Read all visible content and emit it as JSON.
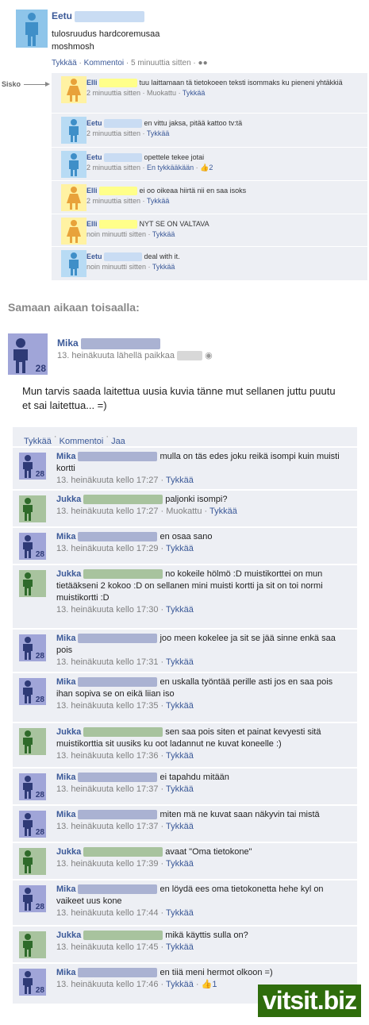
{
  "post1": {
    "author": "Eetu",
    "lines": [
      "tulosruudus hardcoremusaa",
      "moshmosh"
    ],
    "like": "Tykkää",
    "comment": "Kommentoi",
    "time": "5 minuuttia sitten"
  },
  "sisko_label": "Sisko",
  "comments1": [
    {
      "author": "Elli",
      "gender": "f",
      "text": "tuu laittamaan tä tietokoeen teksti isommaks ku pieneni yhtäkkiä",
      "time": "2 minuuttia sitten",
      "extra": "Muokattu",
      "like": "Tykkää"
    },
    {
      "author": "Eetu",
      "gender": "m",
      "text": "en vittu jaksa, pitää kattoo tv:tä",
      "time": "2 minuuttia sitten",
      "extra": "",
      "like": "Tykkää"
    },
    {
      "author": "Eetu",
      "gender": "m",
      "text": "opettele tekee jotai",
      "time": "2 minuuttia sitten",
      "extra": "",
      "like": "En tykkääkään",
      "likes": "2"
    },
    {
      "author": "Elli",
      "gender": "f",
      "text": "ei oo oikeaa hiirtä nii en saa isoks",
      "time": "2 minuuttia sitten",
      "extra": "",
      "like": "Tykkää"
    },
    {
      "author": "Elli",
      "gender": "f",
      "text": "NYT SE ON VALTAVA",
      "time": "noin minuutti sitten",
      "extra": "",
      "like": "Tykkää"
    },
    {
      "author": "Eetu",
      "gender": "m",
      "text": "deal with it.",
      "time": "noin minuutti sitten",
      "extra": "",
      "like": "Tykkää"
    }
  ],
  "section_title": "Samaan aikaan toisaalla:",
  "post2": {
    "author": "Mika",
    "age": "28",
    "meta": "13. heinäkuuta lähellä paikkaa",
    "text": "Mun tarvis saada laitettua uusia kuvia tänne mut sellanen juttu puutu et sai laitettua... =)",
    "actions": [
      "Tykkää",
      "Kommentoi",
      "Jaa"
    ]
  },
  "comments2": [
    {
      "author": "Mika",
      "who": "mika",
      "text": "mulla on täs edes joku reikä isompi kuin muisti kortti",
      "time": "13. heinäkuuta kello 17:27",
      "extra": "",
      "like": "Tykkää"
    },
    {
      "author": "Jukka",
      "who": "jukka",
      "text": "paljonki isompi?",
      "time": "13. heinäkuuta kello 17:27",
      "extra": "Muokattu",
      "like": "Tykkää"
    },
    {
      "author": "Mika",
      "who": "mika",
      "text": "en osaa sano",
      "time": "13. heinäkuuta kello 17:29",
      "extra": "",
      "like": "Tykkää"
    },
    {
      "author": "Jukka",
      "who": "jukka",
      "text": "no kokeile hölmö :D muistikorttei on mun tietääkseni 2 kokoo :D on sellanen mini muisti kortti ja sit on toi normi muistikortti :D",
      "time": "13. heinäkuuta kello 17:30",
      "extra": "",
      "like": "Tykkää"
    },
    {
      "author": "Mika",
      "who": "mika",
      "text": "joo meen kokelee ja sit se jää sinne enkä saa pois",
      "time": "13. heinäkuuta kello 17:31",
      "extra": "",
      "like": "Tykkää"
    },
    {
      "author": "Mika",
      "who": "mika",
      "text": "en uskalla työntää perille asti jos en saa pois ihan sopiva se on eikä liian iso",
      "time": "13. heinäkuuta kello 17:35",
      "extra": "",
      "like": "Tykkää"
    },
    {
      "author": "Jukka",
      "who": "jukka",
      "text": "sen saa pois siten et painat kevyesti sitä muistikorttia sit uusiks ku oot ladannut ne kuvat koneelle :)",
      "time": "13. heinäkuuta kello 17:36",
      "extra": "",
      "like": "Tykkää"
    },
    {
      "author": "Mika",
      "who": "mika",
      "text": "ei tapahdu mitään",
      "time": "13. heinäkuuta kello 17:37",
      "extra": "",
      "like": "Tykkää"
    },
    {
      "author": "Mika",
      "who": "mika",
      "text": "miten mä ne kuvat saan näkyvin tai mistä",
      "time": "13. heinäkuuta kello 17:37",
      "extra": "",
      "like": "Tykkää"
    },
    {
      "author": "Jukka",
      "who": "jukka",
      "text": "avaat \"Oma tietokone\"",
      "time": "13. heinäkuuta kello 17:39",
      "extra": "",
      "like": "Tykkää"
    },
    {
      "author": "Mika",
      "who": "mika",
      "text": "en löydä ees oma tietokonetta hehe kyl on vaikeet uus kone",
      "time": "13. heinäkuuta kello 17:44",
      "extra": "",
      "like": "Tykkää"
    },
    {
      "author": "Jukka",
      "who": "jukka",
      "text": "mikä käyttis sulla on?",
      "time": "13. heinäkuuta kello 17:45",
      "extra": "",
      "like": "Tykkää"
    },
    {
      "author": "Mika",
      "who": "mika",
      "text": "en tiiä meni hermot olkoon =)",
      "time": "13. heinäkuuta kello 17:46",
      "extra": "",
      "like": "Tykkää",
      "likes": "1"
    }
  ],
  "watermark": "vitsit.biz"
}
